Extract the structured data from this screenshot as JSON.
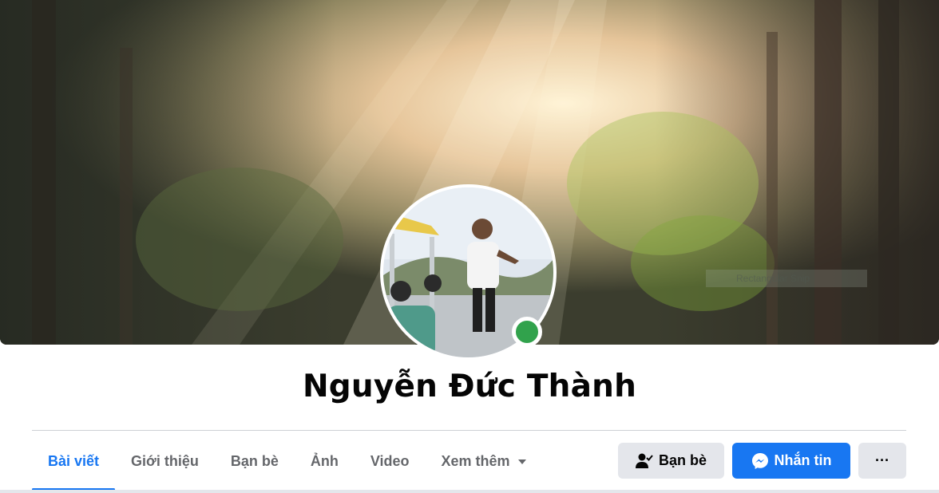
{
  "profile": {
    "name": "Nguyễn Đức Thành",
    "online": true,
    "cover_watermark": "Rectangular Snip"
  },
  "tabs": [
    {
      "label": "Bài viết",
      "active": true
    },
    {
      "label": "Giới thiệu",
      "active": false
    },
    {
      "label": "Bạn bè",
      "active": false
    },
    {
      "label": "Ảnh",
      "active": false
    },
    {
      "label": "Video",
      "active": false
    },
    {
      "label": "Xem thêm",
      "active": false
    }
  ],
  "actions": {
    "friends_label": "Bạn bè",
    "message_label": "Nhắn tin",
    "more_label": "···"
  },
  "colors": {
    "accent": "#1877f2",
    "online": "#31a24c",
    "secondary_button": "#e4e6eb",
    "text_muted": "#65676b"
  },
  "icons": {
    "friends": "person-check-icon",
    "message": "messenger-icon",
    "more": "more-dots-icon",
    "dropdown": "caret-down-icon"
  }
}
